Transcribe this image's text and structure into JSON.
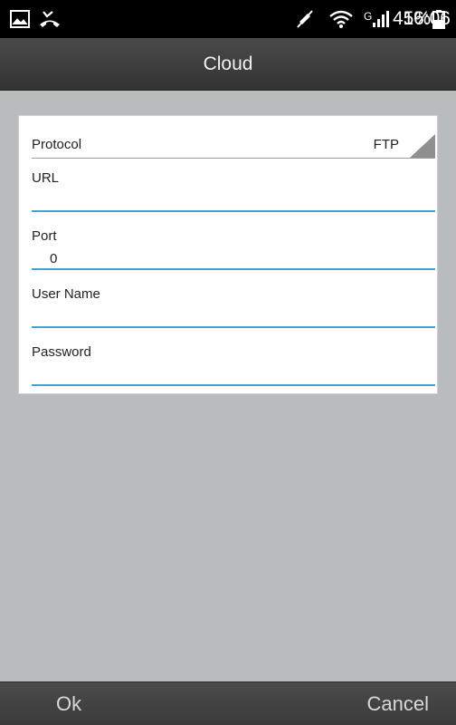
{
  "status_bar": {
    "icons": [
      "image-icon",
      "missed-call-icon",
      "mute-icon",
      "wifi-icon",
      "signal-icon",
      "battery-icon"
    ],
    "network_label": "G",
    "battery": "45%",
    "time": "16:06"
  },
  "header": {
    "title": "Cloud"
  },
  "form": {
    "protocol_label": "Protocol",
    "protocol_value": "FTP",
    "url_label": "URL",
    "url_value": "",
    "port_label": "Port",
    "port_value": "0",
    "username_label": "User Name",
    "username_value": "",
    "password_label": "Password",
    "password_value": ""
  },
  "actions": {
    "ok_label": "Ok",
    "cancel_label": "Cancel"
  },
  "colors": {
    "accent": "#3aa7d6",
    "background": "#b9bcbd",
    "bar": "#3c3c3c"
  }
}
